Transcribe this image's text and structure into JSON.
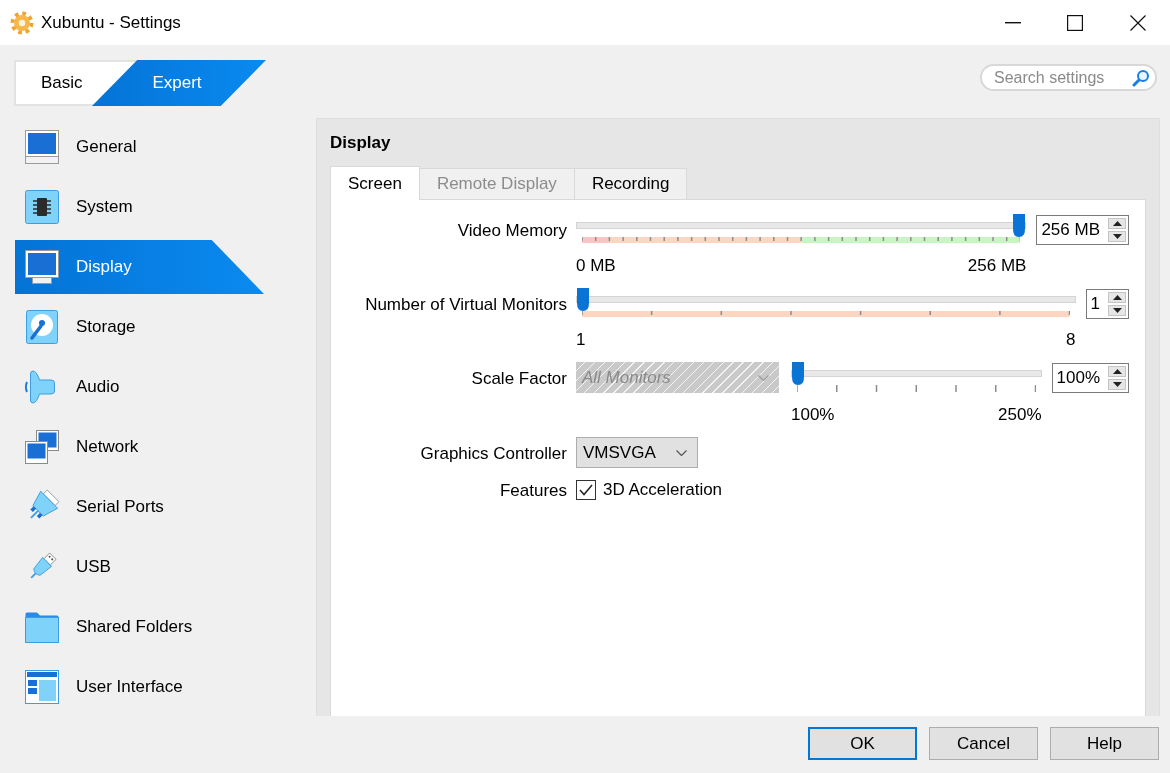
{
  "window": {
    "title": "Xubuntu - Settings"
  },
  "mode_switch": [
    {
      "label": "Basic",
      "selected": false
    },
    {
      "label": "Expert",
      "selected": true
    }
  ],
  "search": {
    "placeholder": "Search settings"
  },
  "sidebar": {
    "items": [
      {
        "label": "General",
        "selected": false
      },
      {
        "label": "System",
        "selected": false
      },
      {
        "label": "Display",
        "selected": true
      },
      {
        "label": "Storage",
        "selected": false
      },
      {
        "label": "Audio",
        "selected": false
      },
      {
        "label": "Network",
        "selected": false
      },
      {
        "label": "Serial Ports",
        "selected": false
      },
      {
        "label": "USB",
        "selected": false
      },
      {
        "label": "Shared Folders",
        "selected": false
      },
      {
        "label": "User Interface",
        "selected": false
      }
    ]
  },
  "panel": {
    "title": "Display",
    "tabs": [
      {
        "label": "Screen",
        "selected": true,
        "disabled": false
      },
      {
        "label": "Remote Display",
        "selected": false,
        "disabled": true
      },
      {
        "label": "Recording",
        "selected": false,
        "disabled": false
      }
    ],
    "rows": [
      {
        "kind": "slider",
        "label": "Video Memory",
        "level": 1,
        "value": "256 MB",
        "min_label": "0 MB",
        "max_label": "256 MB"
      },
      {
        "kind": "slider",
        "label": "Number of Virtual Monitors",
        "level": 0,
        "value": "1",
        "min_label": "1",
        "max_label": "8"
      },
      {
        "kind": "slider",
        "label": "Scale Factor",
        "combo": {
          "value": "All Monitors",
          "disabled": true
        },
        "level": 0,
        "value": "100%",
        "min_label": "100%",
        "max_label": "250%"
      },
      {
        "kind": "combo",
        "label": "Graphics Controller",
        "value": "VMSVGA",
        "disabled": false
      },
      {
        "kind": "checkbox",
        "label": "Features",
        "option": "3D Acceleration",
        "checked": true
      }
    ]
  },
  "buttons": [
    {
      "label": "OK",
      "default": true
    },
    {
      "label": "Cancel",
      "default": false
    },
    {
      "label": "Help",
      "default": false
    }
  ]
}
